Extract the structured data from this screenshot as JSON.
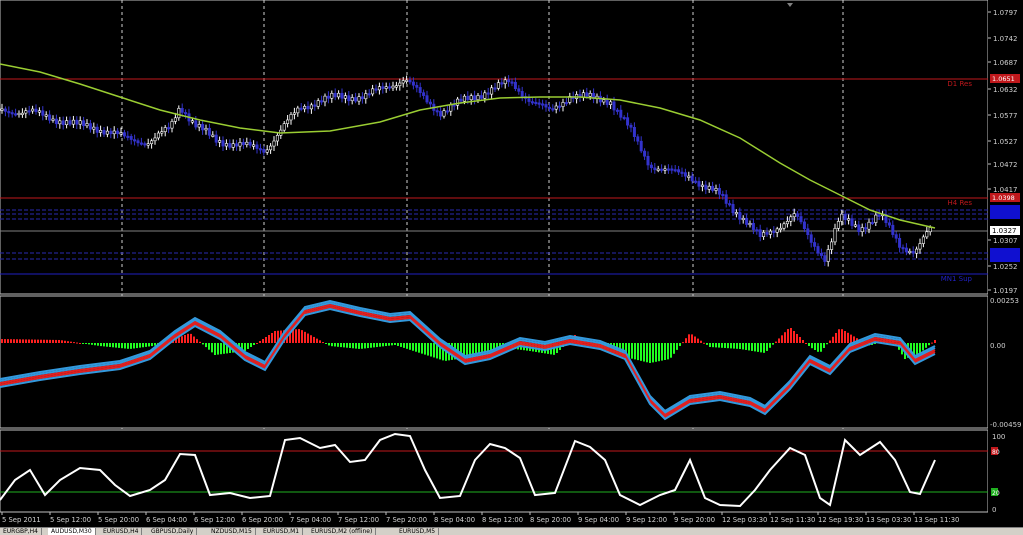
{
  "main_panel": {
    "price_ticks": [
      "1.0797",
      "1.0742",
      "1.0687",
      "1.0632",
      "1.0577",
      "1.0527",
      "1.0472",
      "1.0417",
      "1.0307",
      "1.0252",
      "1.0197"
    ],
    "current_price": "1.0327",
    "levels": [
      {
        "label": "D1 Res",
        "price_tag": "1.0651",
        "color": "#c0181c"
      },
      {
        "label": "H4 Res",
        "price_tag": "1.0398",
        "color": "#c0181c"
      },
      {
        "label": "MN1 Sup",
        "price_tag": "",
        "color": "#2020c0"
      }
    ]
  },
  "macd_panel": {
    "ticks": [
      "0.00253",
      "0.00",
      "-0.00459"
    ]
  },
  "stoch_panel": {
    "ticks": [
      "100",
      "0"
    ],
    "upper_marker": "80",
    "lower_marker": "20"
  },
  "time_axis": [
    "5 Sep 2011",
    "5 Sep 12:00",
    "5 Sep 20:00",
    "6 Sep 04:00",
    "6 Sep 12:00",
    "6 Sep 20:00",
    "7 Sep 04:00",
    "7 Sep 12:00",
    "7 Sep 20:00",
    "8 Sep 04:00",
    "8 Sep 12:00",
    "8 Sep 20:00",
    "9 Sep 04:00",
    "9 Sep 12:00",
    "9 Sep 20:00",
    "12 Sep 03:30",
    "12 Sep 11:30",
    "12 Sep 19:30",
    "13 Sep 03:30",
    "13 Sep 11:30"
  ],
  "tabs": [
    {
      "label": "EURGBP,H4",
      "active": false
    },
    {
      "label": "AUDUSD,M30",
      "active": true
    },
    {
      "label": "EURUSD,H4",
      "active": false
    },
    {
      "label": "GBPUSD,Daily",
      "active": false
    },
    {
      "label": "NZDUSD,M15",
      "active": false
    },
    {
      "label": "EURUSD,M1",
      "active": false
    },
    {
      "label": "EURUSD,M2 (offline)",
      "active": false
    },
    {
      "label": "EURUSD,M5",
      "active": false
    }
  ],
  "colors": {
    "bull": "#ffffff",
    "bear": "#3333cc",
    "ma": "#9acd32",
    "res": "#c0181c",
    "sup": "#2020c0",
    "macd_pos": "#ff2020",
    "macd_neg": "#20ff20",
    "signal_a": "#e02020",
    "signal_b": "#3399dd"
  }
}
